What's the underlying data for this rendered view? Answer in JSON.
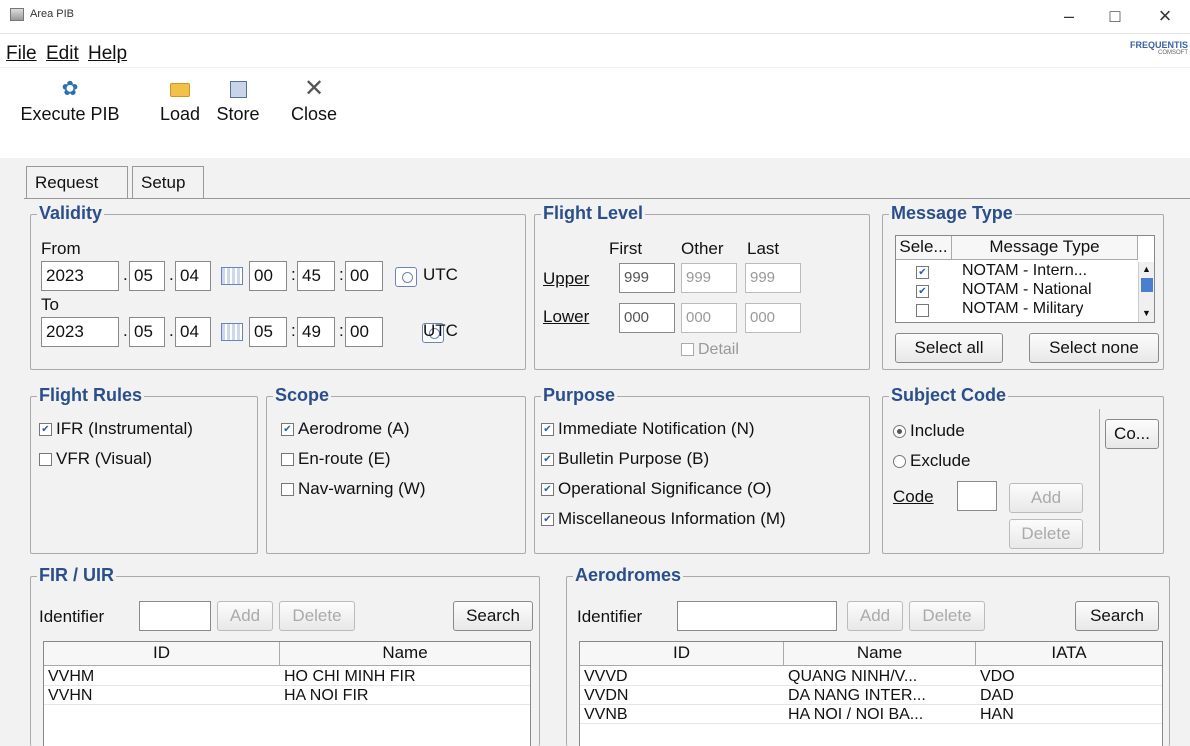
{
  "window": {
    "title": "Area PIB",
    "minimize": "–",
    "maximize": "□",
    "close": "×"
  },
  "menu": {
    "file": "File",
    "edit": "Edit",
    "help": "Help",
    "brand": "FREQUENTIS",
    "brand_sub": "COMSOFT"
  },
  "toolbar": {
    "execute": "Execute PIB",
    "load": "Load",
    "store": "Store",
    "close": "Close"
  },
  "tabs": {
    "request": "Request",
    "setup": "Setup"
  },
  "validity": {
    "title": "Validity",
    "from_label": "From",
    "to_label": "To",
    "from": {
      "year": "2023",
      "month": "05",
      "day": "04",
      "hour": "00",
      "min": "45",
      "sec": "00",
      "tz": "UTC"
    },
    "to": {
      "year": "2023",
      "month": "05",
      "day": "04",
      "hour": "05",
      "min": "49",
      "sec": "00",
      "tz": "UTC"
    }
  },
  "flight_level": {
    "title": "Flight Level",
    "col_first": "First",
    "col_other": "Other",
    "col_last": "Last",
    "upper_label": "Upper",
    "lower_label": "Lower",
    "upper": {
      "first": "999",
      "other": "999",
      "last": "999"
    },
    "lower": {
      "first": "000",
      "other": "000",
      "last": "000"
    },
    "detail": "Detail"
  },
  "message_type": {
    "title": "Message Type",
    "col_sel": "Sele...",
    "col_type": "Message Type",
    "rows": [
      {
        "checked": true,
        "label": "NOTAM - Intern..."
      },
      {
        "checked": true,
        "label": "NOTAM - National"
      },
      {
        "checked": false,
        "label": "NOTAM - Military"
      }
    ],
    "select_all": "Select all",
    "select_none": "Select none"
  },
  "flight_rules": {
    "title": "Flight Rules",
    "ifr": "IFR (Instrumental)",
    "vfr": "VFR (Visual)",
    "ifr_checked": true,
    "vfr_checked": false
  },
  "scope": {
    "title": "Scope",
    "aerodrome": "Aerodrome (A)",
    "enroute": "En-route (E)",
    "navwarning": "Nav-warning (W)"
  },
  "purpose": {
    "title": "Purpose",
    "immediate": "Immediate Notification (N)",
    "bulletin": "Bulletin Purpose (B)",
    "operational": "Operational Significance (O)",
    "misc": "Miscellaneous Information (M)"
  },
  "subject_code": {
    "title": "Subject Code",
    "include": "Include",
    "exclude": "Exclude",
    "code_label": "Code",
    "add": "Add",
    "delete": "Delete",
    "co": "Co..."
  },
  "fir": {
    "title": "FIR / UIR",
    "identifier": "Identifier",
    "add": "Add",
    "delete": "Delete",
    "search": "Search",
    "col_id": "ID",
    "col_name": "Name",
    "rows": [
      {
        "id": "VVHM",
        "name": "HO CHI MINH FIR"
      },
      {
        "id": "VVHN",
        "name": "HA NOI FIR"
      }
    ]
  },
  "aerodromes": {
    "title": "Aerodromes",
    "identifier": "Identifier",
    "add": "Add",
    "delete": "Delete",
    "search": "Search",
    "col_id": "ID",
    "col_name": "Name",
    "col_iata": "IATA",
    "rows": [
      {
        "id": "VVVD",
        "name": "QUANG NINH/V...",
        "iata": "VDO"
      },
      {
        "id": "VVDN",
        "name": "DA NANG INTER...",
        "iata": "DAD"
      },
      {
        "id": "VVNB",
        "name": "HA NOI / NOI BA...",
        "iata": "HAN"
      }
    ]
  }
}
